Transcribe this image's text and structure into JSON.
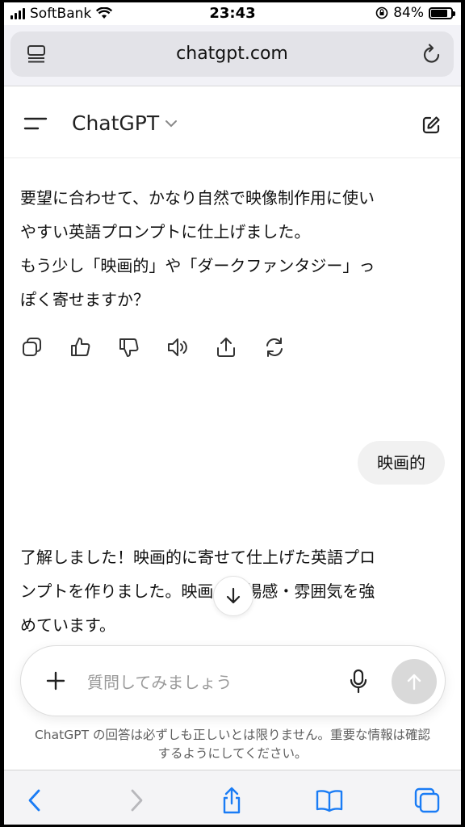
{
  "status_bar": {
    "carrier": "SoftBank",
    "time": "23:43",
    "battery_label": "84%",
    "battery_level": 0.84
  },
  "browser": {
    "url": "chatgpt.com"
  },
  "chat": {
    "title": "ChatGPT",
    "assistant_message_1": [
      "要望に合わせて、かなり自然で映像制作用に使い",
      "やすい英語プロンプトに仕上げました。",
      "もう少し「映画的」や「ダークファンタジー」っ",
      "ぽく寄せますか？"
    ],
    "action_icons": [
      "copy-icon",
      "thumbs-up-icon",
      "thumbs-down-icon",
      "speaker-icon",
      "share-icon",
      "regenerate-icon"
    ],
    "user_message": "映画的",
    "assistant_message_2": [
      "了解しました！映画的に寄せて仕上げた英語プロ",
      "ンプトを作りました。映画の臨場感・雰囲気を強",
      "めています。"
    ]
  },
  "composer": {
    "placeholder": "質問してみましょう"
  },
  "disclaimer": [
    "ChatGPT の回答は必ずしも正しいとは限りません。重要な情報は確認",
    "するようにしてください。"
  ],
  "toolbar_icons": [
    "back-icon",
    "forward-icon",
    "share-icon",
    "bookmarks-icon",
    "tabs-icon"
  ],
  "colors": {
    "accent": "#1a7cf5",
    "send_disabled": "#d9d9d9"
  }
}
